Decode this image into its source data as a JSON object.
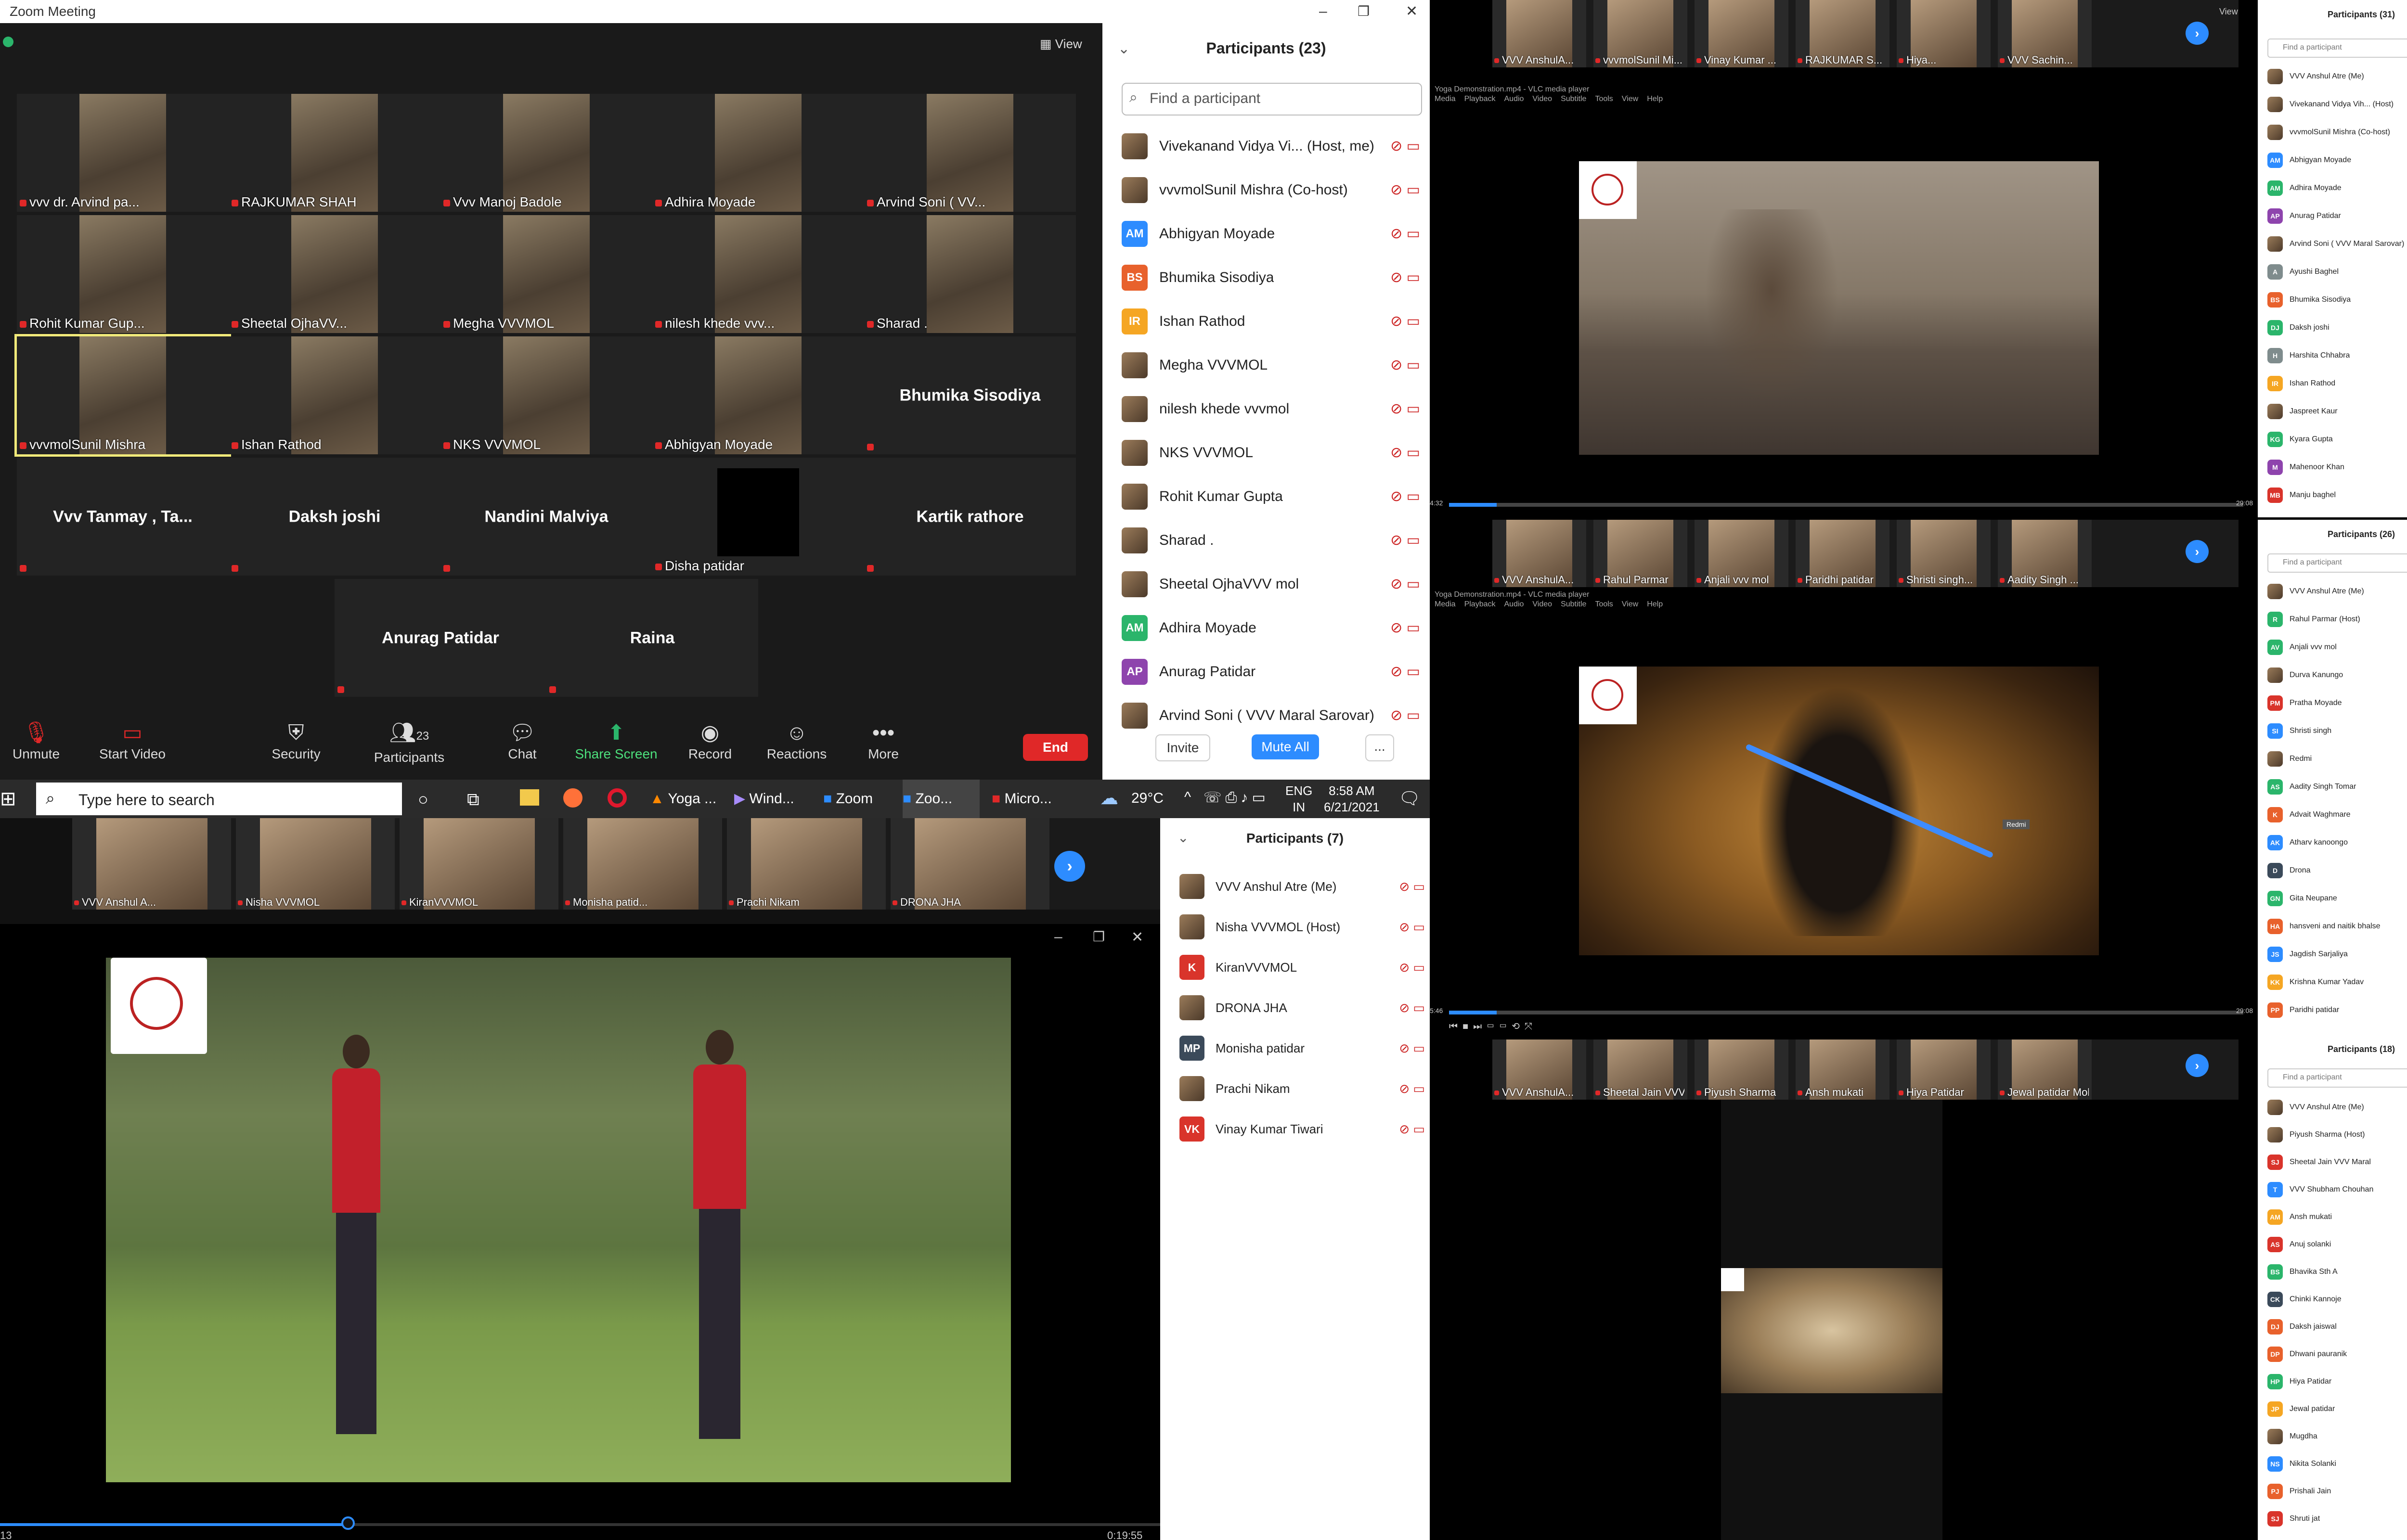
{
  "zoom_main": {
    "window_title": "Zoom Meeting",
    "view_label": "View",
    "tiles": [
      {
        "name": "vvv dr. Arvind pa...",
        "video": true
      },
      {
        "name": "RAJKUMAR SHAH",
        "video": true
      },
      {
        "name": "Vvv Manoj Badole",
        "video": true
      },
      {
        "name": "Adhira Moyade",
        "video": true
      },
      {
        "name": "Arvind Soni ( VV...",
        "video": true
      },
      {
        "name": "Rohit Kumar Gup...",
        "video": true
      },
      {
        "name": "Sheetal OjhaVV...",
        "video": true
      },
      {
        "name": "Megha VVVMOL",
        "video": true
      },
      {
        "name": "nilesh khede vvv...",
        "video": true
      },
      {
        "name": "Sharad .",
        "video": true
      },
      {
        "name": "vvvmolSunil Mishra",
        "video": true
      },
      {
        "name": "Ishan Rathod",
        "video": true
      },
      {
        "name": "NKS VVVMOL",
        "video": true
      },
      {
        "name": "Abhigyan Moyade",
        "video": true
      },
      {
        "name": "Bhumika Sisodiya",
        "video": false
      },
      {
        "name": "Vvv Tanmay , Ta...",
        "video": false
      },
      {
        "name": "Daksh joshi",
        "video": false
      },
      {
        "name": "Nandini Malviya",
        "video": false
      },
      {
        "name": "Disha patidar",
        "video": true
      },
      {
        "name": "Kartik rathore",
        "video": false
      },
      {
        "name": "Anurag Patidar",
        "video": false
      },
      {
        "name": "Raina",
        "video": false
      }
    ],
    "toolbar": {
      "unmute": "Unmute",
      "start_video": "Start Video",
      "security": "Security",
      "participants": "Participants",
      "participants_count": "23",
      "chat": "Chat",
      "share_screen": "Share Screen",
      "record": "Record",
      "reactions": "Reactions",
      "more": "More",
      "end": "End"
    }
  },
  "participants_main": {
    "title": "Participants (23)",
    "search_placeholder": "Find a participant",
    "items": [
      {
        "name": "Vivekanand Vidya Vi... (Host, me)",
        "initials": "",
        "color": ""
      },
      {
        "name": "vvvmolSunil Mishra (Co-host)",
        "initials": "",
        "color": ""
      },
      {
        "name": "Abhigyan Moyade",
        "initials": "AM",
        "color": "#2d8cff"
      },
      {
        "name": "Bhumika Sisodiya",
        "initials": "BS",
        "color": "#e8612c"
      },
      {
        "name": "Ishan Rathod",
        "initials": "IR",
        "color": "#f5a623"
      },
      {
        "name": "Megha VVVMOL",
        "initials": "",
        "color": ""
      },
      {
        "name": "nilesh khede vvvmol",
        "initials": "",
        "color": ""
      },
      {
        "name": "NKS VVVMOL",
        "initials": "",
        "color": ""
      },
      {
        "name": "Rohit Kumar Gupta",
        "initials": "",
        "color": ""
      },
      {
        "name": "Sharad .",
        "initials": "",
        "color": ""
      },
      {
        "name": "Sheetal OjhaVVV mol",
        "initials": "",
        "color": ""
      },
      {
        "name": "Adhira Moyade",
        "initials": "AM",
        "color": "#2bb56b"
      },
      {
        "name": "Anurag Patidar",
        "initials": "AP",
        "color": "#8e44ad"
      },
      {
        "name": "Arvind Soni ( VVV Maral Sarovar)",
        "initials": "",
        "color": ""
      }
    ],
    "invite": "Invite",
    "mute_all": "Mute All",
    "more": "..."
  },
  "taskbar": {
    "search_placeholder": "Type here to search",
    "apps": [
      "Yoga ...",
      "Wind...",
      "Zoom",
      "Zoo...",
      "Micro..."
    ],
    "weather": "29°C",
    "lang1": "ENG",
    "lang2": "IN",
    "time": "8:58 AM",
    "date": "6/21/2021"
  },
  "bottom_left": {
    "thumbs": [
      "VVV Anshul A...",
      "Nisha VVVMOL",
      "KiranVVVMOL",
      "Monisha patid...",
      "Prachi Nikam",
      "DRONA JHA"
    ],
    "participants_title": "Participants (7)",
    "participants": [
      {
        "name": "VVV Anshul Atre (Me)",
        "initials": "",
        "color": ""
      },
      {
        "name": "Nisha VVVMOL (Host)",
        "initials": "",
        "color": ""
      },
      {
        "name": "KiranVVVMOL",
        "initials": "K",
        "color": "#d9342b"
      },
      {
        "name": "DRONA JHA",
        "initials": "",
        "color": ""
      },
      {
        "name": "Monisha patidar",
        "initials": "MP",
        "color": "#3b4a5a"
      },
      {
        "name": "Prachi Nikam",
        "initials": "",
        "color": ""
      },
      {
        "name": "Vinay Kumar Tiwari",
        "initials": "VK",
        "color": "#d9342b"
      }
    ],
    "video_elapsed": "13",
    "video_total": "0:19:55"
  },
  "right_top": {
    "thumbs": [
      "VVV AnshulA...",
      "vvvmolSunil Mi...",
      "Vinay Kumar ...",
      "RAJKUMAR S...",
      "Hiya...",
      "VVV Sachin..."
    ],
    "view_label": "View",
    "vlc_title": "Yoga Demonstration.mp4 - VLC media player",
    "vlc_menu": [
      "Media",
      "Playback",
      "Audio",
      "Video",
      "Subtitle",
      "Tools",
      "View",
      "Help"
    ],
    "elapsed": "4:32",
    "total": "29:08",
    "participants_title": "Participants (31)",
    "search_placeholder": "Find a participant",
    "participants": [
      {
        "name": "VVV Anshul Atre (Me)",
        "initials": "",
        "color": ""
      },
      {
        "name": "Vivekanand Vidya Vih... (Host)",
        "initials": "",
        "color": ""
      },
      {
        "name": "vvvmolSunil Mishra (Co-host)",
        "initials": "",
        "color": ""
      },
      {
        "name": "Abhigyan Moyade",
        "initials": "AM",
        "color": "#2d8cff"
      },
      {
        "name": "Adhira Moyade",
        "initials": "AM",
        "color": "#2bb56b"
      },
      {
        "name": "Anurag Patidar",
        "initials": "AP",
        "color": "#8e44ad"
      },
      {
        "name": "Arvind Soni ( VVV Maral Sarovar)",
        "initials": "",
        "color": ""
      },
      {
        "name": "Ayushi Baghel",
        "initials": "A",
        "color": "#7f8c8d"
      },
      {
        "name": "Bhumika Sisodiya",
        "initials": "BS",
        "color": "#e8612c"
      },
      {
        "name": "Daksh joshi",
        "initials": "DJ",
        "color": "#2bb56b"
      },
      {
        "name": "Harshita Chhabra",
        "initials": "H",
        "color": "#7f8c8d"
      },
      {
        "name": "Ishan Rathod",
        "initials": "IR",
        "color": "#f5a623"
      },
      {
        "name": "Jaspreet Kaur",
        "initials": "",
        "color": ""
      },
      {
        "name": "Kyara Gupta",
        "initials": "KG",
        "color": "#2bb56b"
      },
      {
        "name": "Mahenoor Khan",
        "initials": "M",
        "color": "#8e44ad"
      },
      {
        "name": "Manju baghel",
        "initials": "MB",
        "color": "#d9342b"
      }
    ]
  },
  "right_mid": {
    "thumbs": [
      "VVV AnshulA...",
      "Rahul Parmar",
      "Anjali vvv mol",
      "Paridhi patidar",
      "Shristi singh...",
      "Aadity Singh ..."
    ],
    "vlc_title": "Yoga Demonstration.mp4 - VLC media player",
    "vlc_menu": [
      "Media",
      "Playback",
      "Audio",
      "Video",
      "Subtitle",
      "Tools",
      "View",
      "Help"
    ],
    "pointer_label": "Redmi",
    "elapsed": "5:46",
    "total": "29:08",
    "participants_title": "Participants (26)",
    "search_placeholder": "Find a participant",
    "participants": [
      {
        "name": "VVV Anshul Atre (Me)",
        "initials": "",
        "color": ""
      },
      {
        "name": "Rahul Parmar (Host)",
        "initials": "R",
        "color": "#2bb56b"
      },
      {
        "name": "Anjali vvv mol",
        "initials": "AV",
        "color": "#2bb56b"
      },
      {
        "name": "Durva Kanungo",
        "initials": "",
        "color": ""
      },
      {
        "name": "Pratha Moyade",
        "initials": "PM",
        "color": "#d9342b"
      },
      {
        "name": "Shristi singh",
        "initials": "SI",
        "color": "#2d8cff"
      },
      {
        "name": "Redmi",
        "initials": "",
        "color": ""
      },
      {
        "name": "Aadity Singh Tomar",
        "initials": "AS",
        "color": "#2bb56b"
      },
      {
        "name": "Advait Waghmare",
        "initials": "K",
        "color": "#e8612c"
      },
      {
        "name": "Atharv kanoongo",
        "initials": "AK",
        "color": "#2d8cff"
      },
      {
        "name": "Drona",
        "initials": "D",
        "color": "#3b4a5a"
      },
      {
        "name": "Gita Neupane",
        "initials": "GN",
        "color": "#2bb56b"
      },
      {
        "name": "hansveni and naitik bhalse",
        "initials": "HA",
        "color": "#e8612c"
      },
      {
        "name": "Jagdish Sarjaliya",
        "initials": "JS",
        "color": "#2d8cff"
      },
      {
        "name": "Krishna Kumar Yadav",
        "initials": "KK",
        "color": "#f5a623"
      },
      {
        "name": "Paridhi patidar",
        "initials": "PP",
        "color": "#e8612c"
      }
    ]
  },
  "right_bottom": {
    "thumbs": [
      "VVV AnshulA...",
      "Sheetal Jain VVV...",
      "Piyush Sharma",
      "Ansh mukati",
      "Hiya Patidar",
      "Jewal patidar Mol"
    ],
    "participants_title": "Participants (18)",
    "search_placeholder": "Find a participant",
    "participants": [
      {
        "name": "VVV Anshul Atre (Me)",
        "initials": "",
        "color": ""
      },
      {
        "name": "Piyush Sharma (Host)",
        "initials": "",
        "color": ""
      },
      {
        "name": "Sheetal Jain VVV Maral",
        "initials": "SJ",
        "color": "#d9342b"
      },
      {
        "name": "VVV Shubham Chouhan",
        "initials": "T",
        "color": "#2d8cff"
      },
      {
        "name": "Ansh mukati",
        "initials": "AM",
        "color": "#f5a623"
      },
      {
        "name": "Anuj solanki",
        "initials": "AS",
        "color": "#d9342b"
      },
      {
        "name": "Bhavika Sth A",
        "initials": "BS",
        "color": "#2bb56b"
      },
      {
        "name": "Chinki Kannoje",
        "initials": "CK",
        "color": "#3b4a5a"
      },
      {
        "name": "Daksh jaiswal",
        "initials": "DJ",
        "color": "#e8612c"
      },
      {
        "name": "Dhwani pauranik",
        "initials": "DP",
        "color": "#e8612c"
      },
      {
        "name": "Hiya Patidar",
        "initials": "HP",
        "color": "#2bb56b"
      },
      {
        "name": "Jewal patidar",
        "initials": "JP",
        "color": "#f5a623"
      },
      {
        "name": "Mugdha",
        "initials": "",
        "color": ""
      },
      {
        "name": "Nikita Solanki",
        "initials": "NS",
        "color": "#2d8cff"
      },
      {
        "name": "Prishali Jain",
        "initials": "PJ",
        "color": "#e8612c"
      },
      {
        "name": "Shruti jat",
        "initials": "SJ",
        "color": "#d9342b"
      }
    ]
  }
}
